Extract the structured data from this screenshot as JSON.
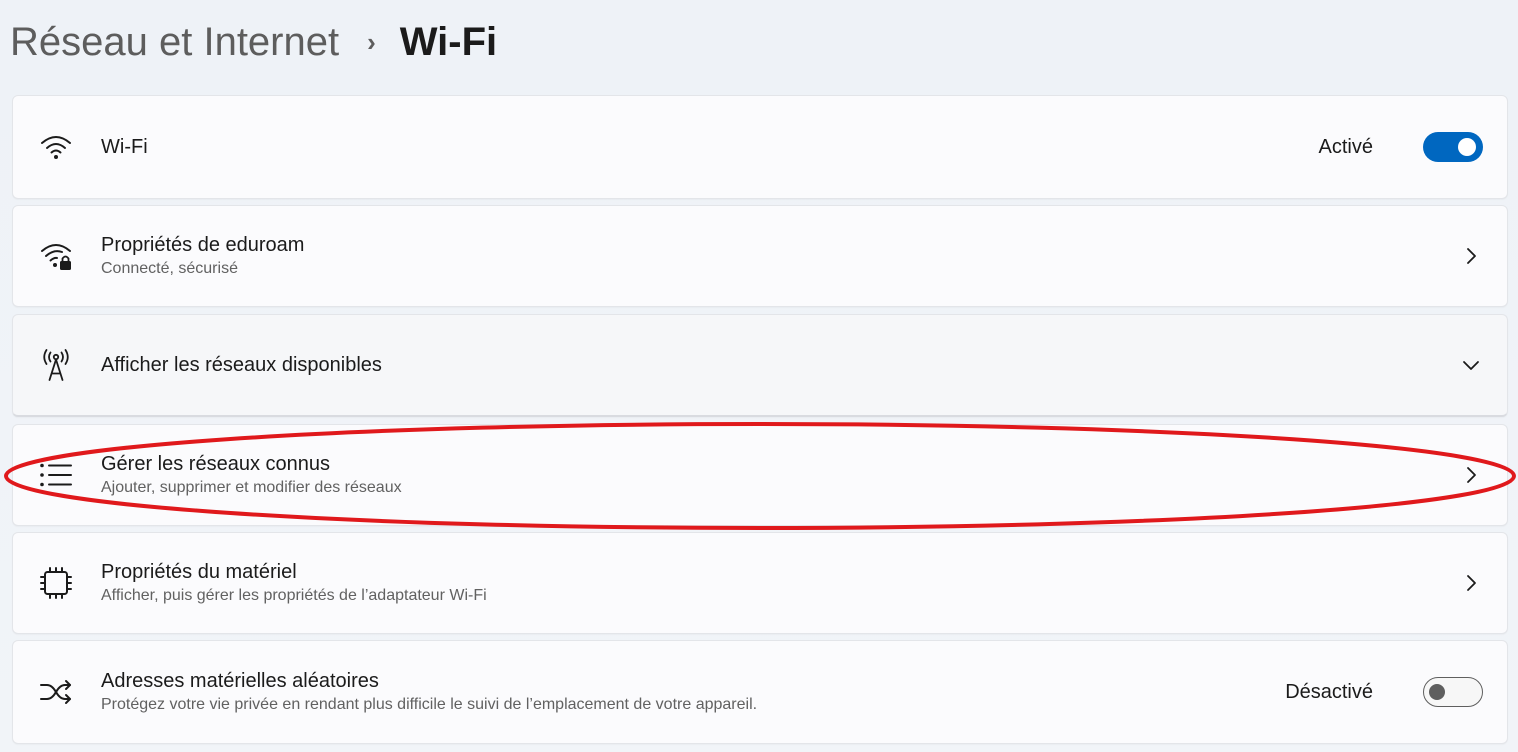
{
  "breadcrumb": {
    "parent": "Réseau et Internet",
    "separator": "›",
    "current": "Wi-Fi"
  },
  "cards": {
    "wifi": {
      "icon": "wifi-icon",
      "title": "Wi-Fi",
      "state": "Activé",
      "toggle_on": true
    },
    "eduroam": {
      "icon": "wifi-lock-icon",
      "title": "Propriétés de eduroam",
      "subtitle": "Connecté, sécurisé"
    },
    "available": {
      "icon": "antenna-icon",
      "title": "Afficher les réseaux disponibles"
    },
    "known": {
      "icon": "list-icon",
      "title": "Gérer les réseaux connus",
      "subtitle": "Ajouter, supprimer et modifier des réseaux"
    },
    "hardware": {
      "icon": "chip-icon",
      "title": "Propriétés du matériel",
      "subtitle": "Afficher, puis gérer les propriétés de l’adaptateur Wi-Fi"
    },
    "random": {
      "icon": "shuffle-icon",
      "title": "Adresses matérielles aléatoires",
      "subtitle": "Protégez votre vie privée en rendant plus difficile le suivi de l’emplacement de votre appareil.",
      "state": "Désactivé",
      "toggle_on": false
    }
  },
  "colors": {
    "accent": "#0067c0",
    "highlight": "#e0191c"
  }
}
